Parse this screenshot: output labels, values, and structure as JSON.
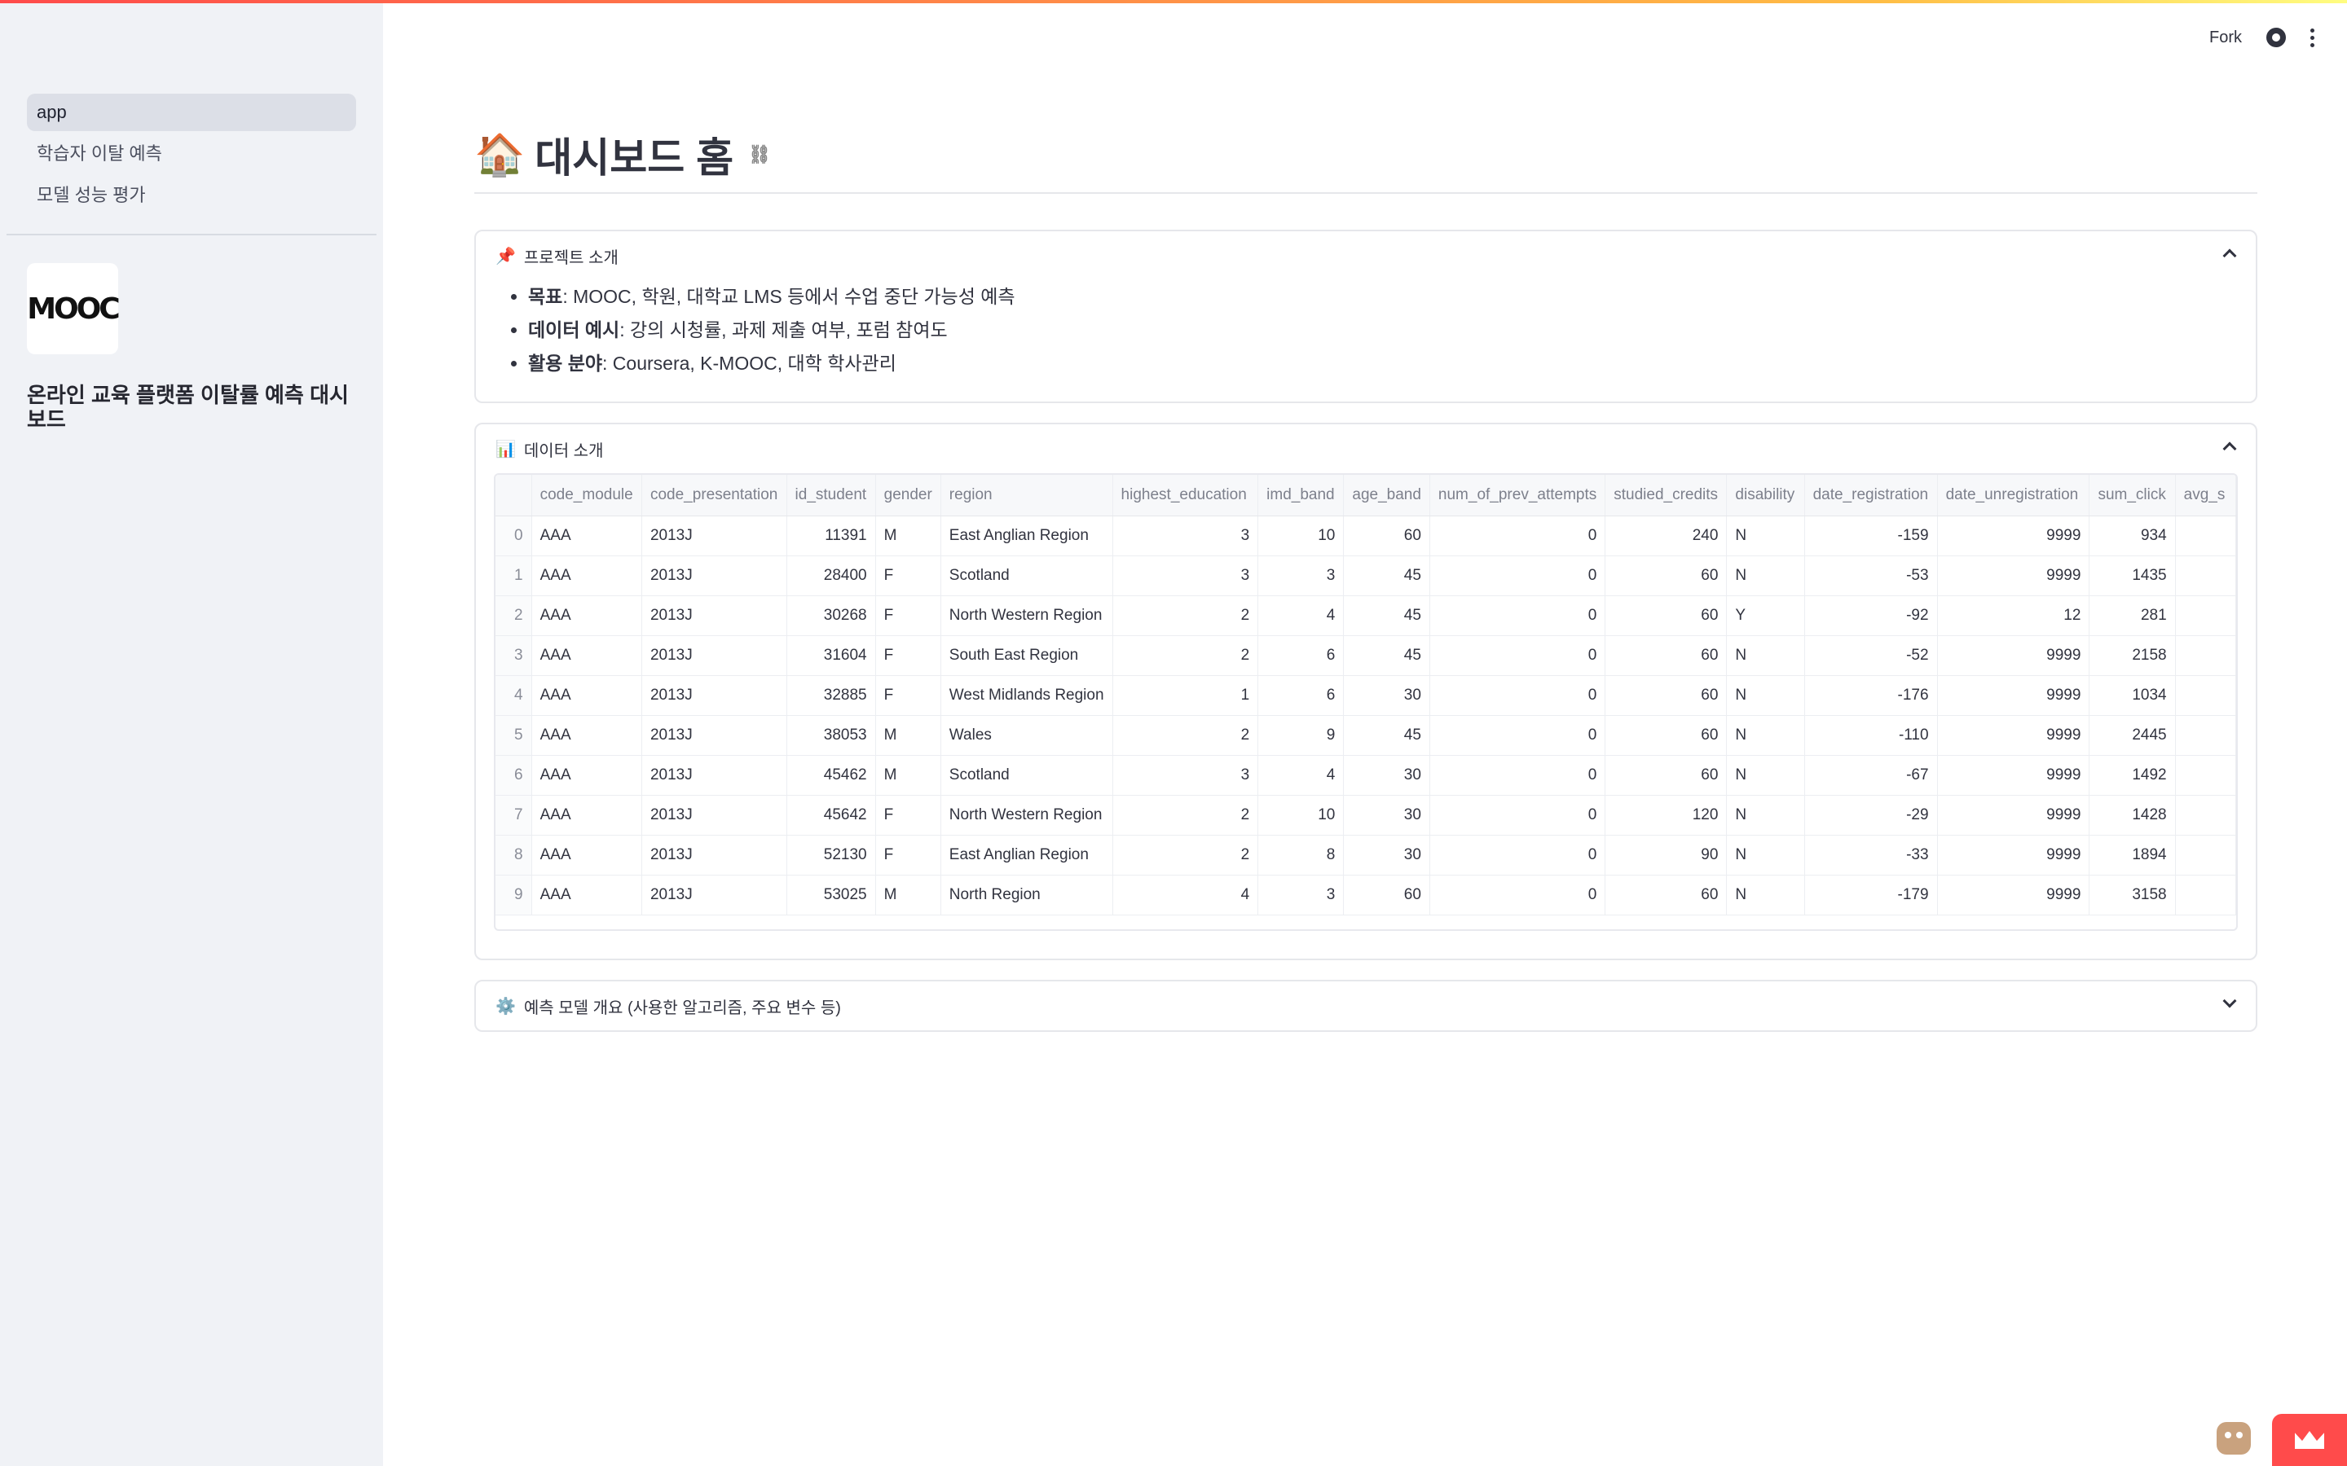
{
  "sidebar": {
    "items": [
      {
        "label": "app",
        "active": true
      },
      {
        "label": "학습자 이탈 예측",
        "active": false
      },
      {
        "label": "모델 성능 평가",
        "active": false
      }
    ],
    "logo_text": "MOOC",
    "title": "온라인 교육 플랫폼 이탈률 예측 대시보드"
  },
  "header": {
    "fork_label": "Fork",
    "github_icon": "github-icon",
    "menu_icon": "kebab-menu-icon"
  },
  "page": {
    "emoji": "🏠",
    "title": "대시보드 홈"
  },
  "sections": {
    "project": {
      "icon": "📌",
      "label": "프로젝트 소개",
      "bullets": [
        {
          "key": "목표",
          "text": ": MOOC, 학원, 대학교 LMS 등에서 수업 중단 가능성 예측"
        },
        {
          "key": "데이터 예시",
          "text": ": 강의 시청률, 과제 제출 여부, 포럼 참여도"
        },
        {
          "key": "활용 분야",
          "text": ": Coursera, K-MOOC, 대학 학사관리"
        }
      ]
    },
    "data": {
      "icon": "📊",
      "label": "데이터 소개",
      "columns": [
        "",
        "code_module",
        "code_presentation",
        "id_student",
        "gender",
        "region",
        "highest_education",
        "imd_band",
        "age_band",
        "num_of_prev_attempts",
        "studied_credits",
        "disability",
        "date_registration",
        "date_unregistration",
        "sum_click",
        "avg_s"
      ],
      "rows": [
        [
          "0",
          "AAA",
          "2013J",
          "11391",
          "M",
          "East Anglian Region",
          "3",
          "10",
          "60",
          "0",
          "240",
          "N",
          "-159",
          "9999",
          "934",
          ""
        ],
        [
          "1",
          "AAA",
          "2013J",
          "28400",
          "F",
          "Scotland",
          "3",
          "3",
          "45",
          "0",
          "60",
          "N",
          "-53",
          "9999",
          "1435",
          ""
        ],
        [
          "2",
          "AAA",
          "2013J",
          "30268",
          "F",
          "North Western Region",
          "2",
          "4",
          "45",
          "0",
          "60",
          "Y",
          "-92",
          "12",
          "281",
          ""
        ],
        [
          "3",
          "AAA",
          "2013J",
          "31604",
          "F",
          "South East Region",
          "2",
          "6",
          "45",
          "0",
          "60",
          "N",
          "-52",
          "9999",
          "2158",
          ""
        ],
        [
          "4",
          "AAA",
          "2013J",
          "32885",
          "F",
          "West Midlands Region",
          "1",
          "6",
          "30",
          "0",
          "60",
          "N",
          "-176",
          "9999",
          "1034",
          ""
        ],
        [
          "5",
          "AAA",
          "2013J",
          "38053",
          "M",
          "Wales",
          "2",
          "9",
          "45",
          "0",
          "60",
          "N",
          "-110",
          "9999",
          "2445",
          ""
        ],
        [
          "6",
          "AAA",
          "2013J",
          "45462",
          "M",
          "Scotland",
          "3",
          "4",
          "30",
          "0",
          "60",
          "N",
          "-67",
          "9999",
          "1492",
          ""
        ],
        [
          "7",
          "AAA",
          "2013J",
          "45642",
          "F",
          "North Western Region",
          "2",
          "10",
          "30",
          "0",
          "120",
          "N",
          "-29",
          "9999",
          "1428",
          ""
        ],
        [
          "8",
          "AAA",
          "2013J",
          "52130",
          "F",
          "East Anglian Region",
          "2",
          "8",
          "30",
          "0",
          "90",
          "N",
          "-33",
          "9999",
          "1894",
          ""
        ],
        [
          "9",
          "AAA",
          "2013J",
          "53025",
          "M",
          "North Region",
          "4",
          "3",
          "60",
          "0",
          "60",
          "N",
          "-179",
          "9999",
          "3158",
          ""
        ]
      ]
    },
    "model": {
      "icon": "⚙️",
      "label": "예측 모델 개요 (사용한 알고리즘, 주요 변수 등)"
    }
  }
}
